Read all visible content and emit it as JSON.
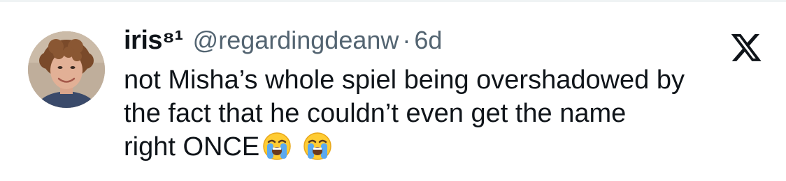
{
  "tweet": {
    "display_name": "iris⁸¹",
    "handle": "@regardingdeanw",
    "separator": "·",
    "time": "6d",
    "text_lines": [
      "not Misha’s whole spiel being overshadowed by",
      "the fact that he couldn’t even get the name",
      "right ONCE"
    ],
    "emojis": [
      "loudly-crying-face",
      "loudly-crying-face"
    ]
  },
  "icons": {
    "brand": "x-logo-icon",
    "avatar": "avatar-image"
  },
  "colors": {
    "text_primary": "#0f1419",
    "text_secondary": "#536471",
    "divider": "#eff3f4",
    "background": "#ffffff"
  }
}
